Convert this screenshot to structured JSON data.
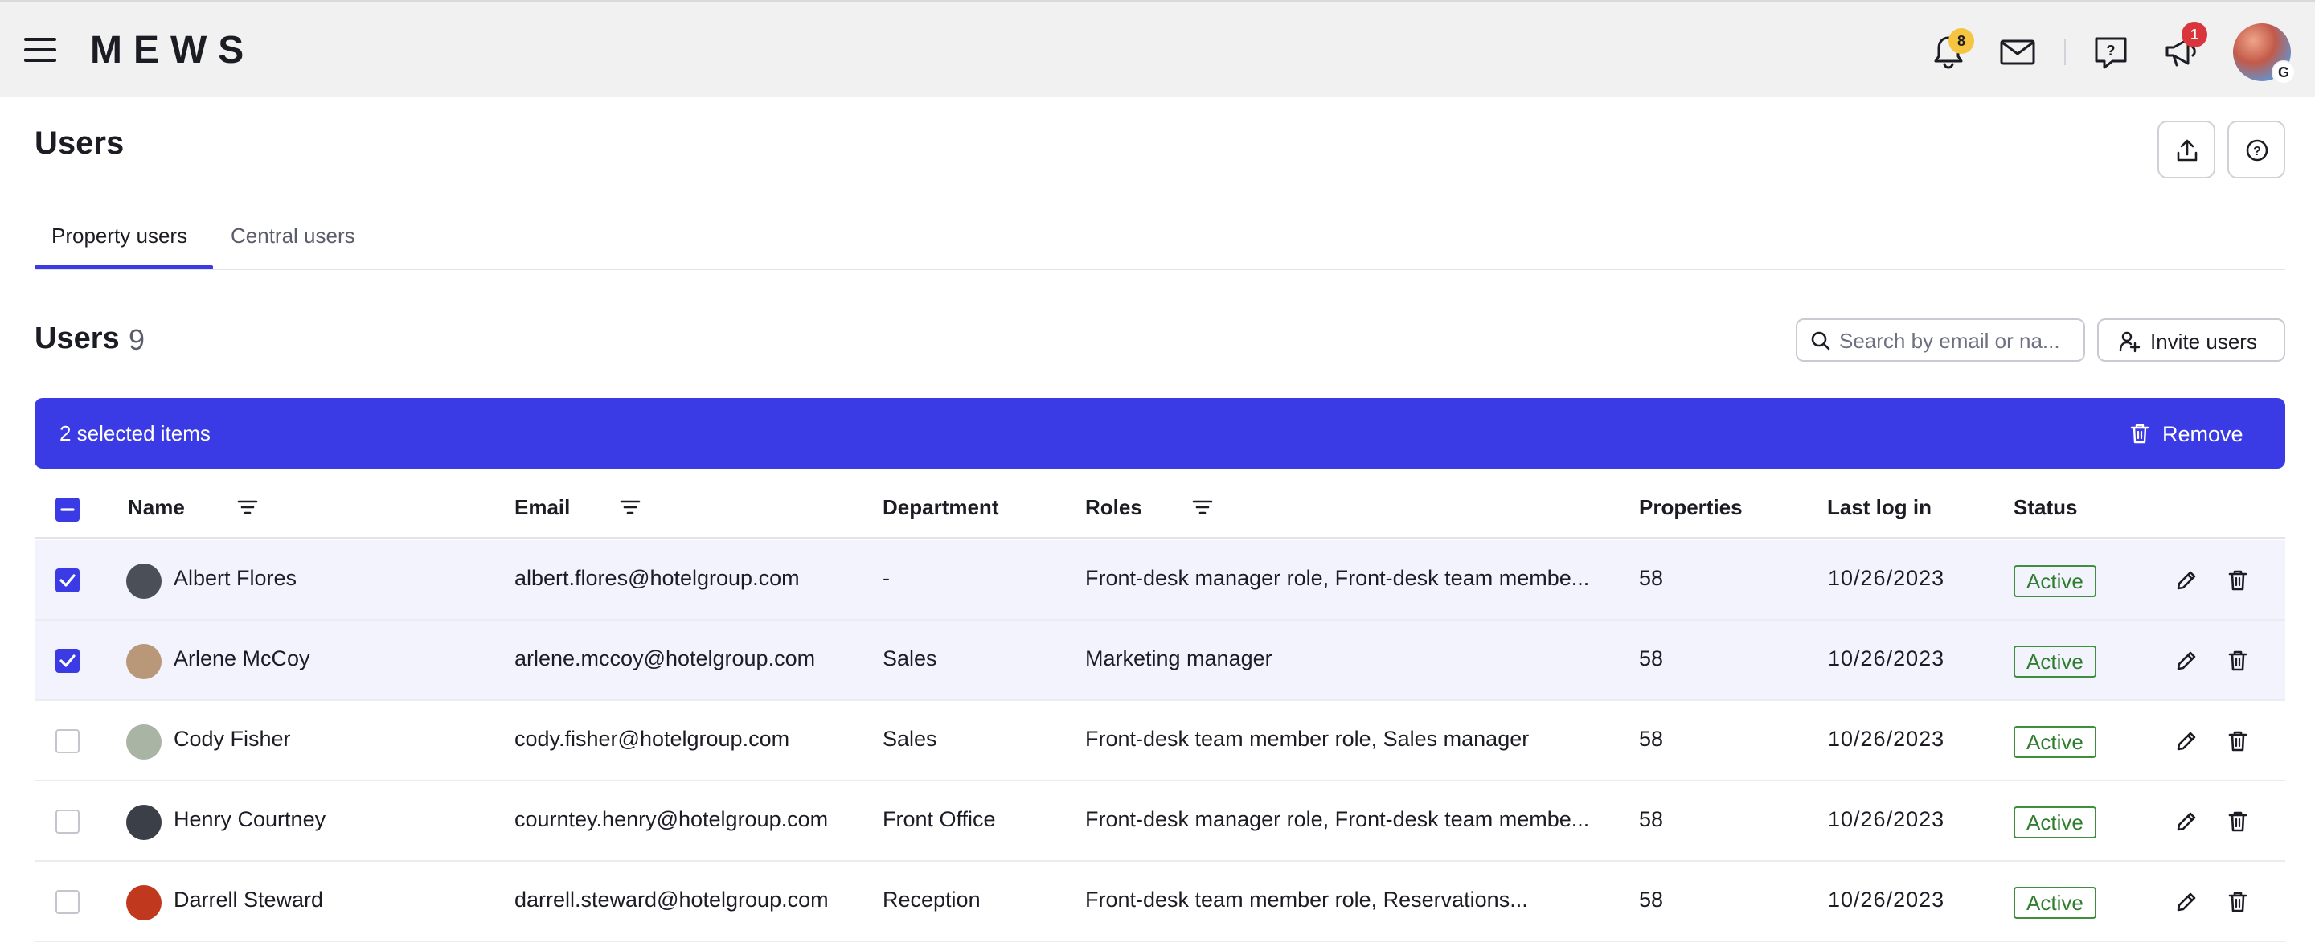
{
  "topbar": {
    "logo": "MEWS",
    "notifications_count": "8",
    "announcements_count": "1",
    "avatar_badge": "G"
  },
  "page": {
    "title": "Users"
  },
  "tabs": [
    {
      "label": "Property users",
      "active": true
    },
    {
      "label": "Central users",
      "active": false
    }
  ],
  "section": {
    "title": "Users",
    "count": "9",
    "search_placeholder": "Search by email or na...",
    "invite_label": "Invite users"
  },
  "selection": {
    "count_text": "2 selected items",
    "remove_label": "Remove"
  },
  "table": {
    "columns": {
      "name": "Name",
      "email": "Email",
      "department": "Department",
      "roles": "Roles",
      "properties": "Properties",
      "last_log_in": "Last log in",
      "status": "Status"
    },
    "rows": [
      {
        "name": "Albert Flores",
        "email": "albert.flores@hotelgroup.com",
        "department": "-",
        "roles": "Front-desk manager role, Front-desk team membe...",
        "properties": "58",
        "last_log_in": "10/26/2023",
        "status": "Active",
        "selected": true,
        "avatar_color": "#4a4f58"
      },
      {
        "name": "Arlene McCoy",
        "email": "arlene.mccoy@hotelgroup.com",
        "department": "Sales",
        "roles": "Marketing manager",
        "properties": "58",
        "last_log_in": "10/26/2023",
        "status": "Active",
        "selected": true,
        "avatar_color": "#b89878"
      },
      {
        "name": "Cody Fisher",
        "email": "cody.fisher@hotelgroup.com",
        "department": "Sales",
        "roles": "Front-desk team member role, Sales manager",
        "properties": "58",
        "last_log_in": "10/26/2023",
        "status": "Active",
        "selected": false,
        "avatar_color": "#a9b4a4"
      },
      {
        "name": "Henry Courtney",
        "email": "courntey.henry@hotelgroup.com",
        "department": "Front Office",
        "roles": "Front-desk manager role, Front-desk team membe...",
        "properties": "58",
        "last_log_in": "10/26/2023",
        "status": "Active",
        "selected": false,
        "avatar_color": "#3a3f48"
      },
      {
        "name": "Darrell Steward",
        "email": "darrell.steward@hotelgroup.com",
        "department": "Reception",
        "roles": "Front-desk team member role, Reservations...",
        "properties": "58",
        "last_log_in": "10/26/2023",
        "status": "Active",
        "selected": false,
        "avatar_color": "#c0391e"
      }
    ]
  },
  "colors": {
    "accent": "#3b3be6",
    "status_active": "#2f7d2f",
    "badge_yellow": "#f5c542",
    "badge_red": "#d8353d"
  },
  "icons": [
    "menu-icon",
    "bell-icon",
    "mail-icon",
    "help-chat-icon",
    "megaphone-icon",
    "export-icon",
    "help-icon",
    "search-icon",
    "add-user-icon",
    "trash-icon",
    "filter-icon",
    "checkbox-icon",
    "edit-icon"
  ]
}
